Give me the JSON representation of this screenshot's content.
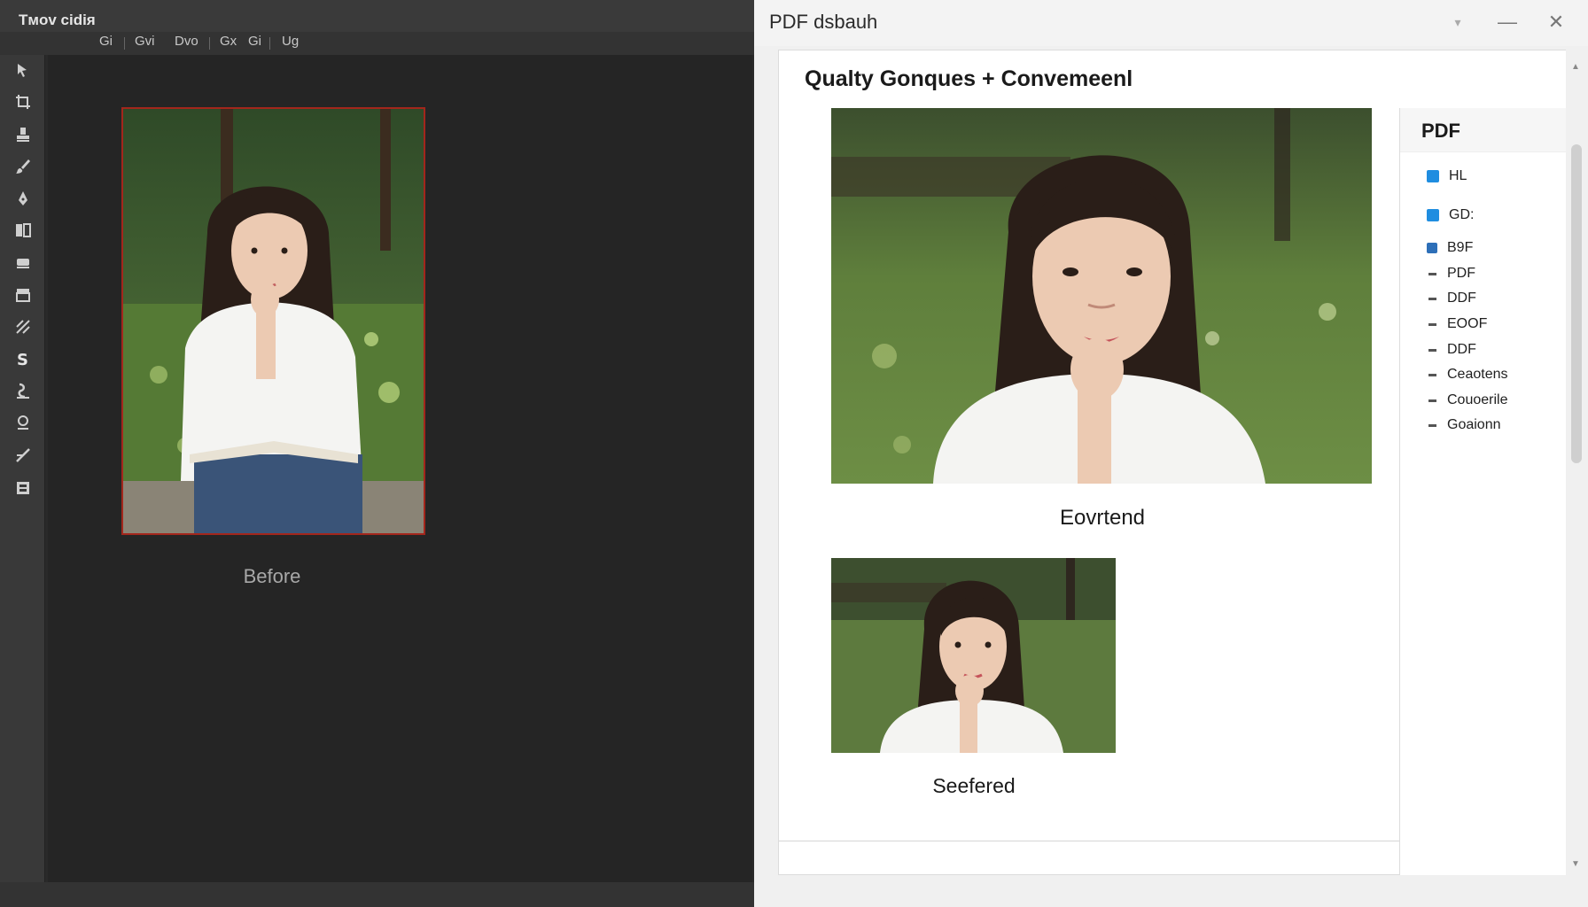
{
  "editor": {
    "title": "Tмov cidiя",
    "menu": [
      "Gi",
      "Gvi",
      "Dvo",
      "Gx",
      "Gi",
      "Ug"
    ],
    "tools": [
      "move-tool",
      "crop-tool",
      "stamp-tool",
      "brush-tool",
      "pen-tool",
      "clone-tool",
      "eraser-tool",
      "fill-tool",
      "gradient-tool",
      "type-tool",
      "smudge-tool",
      "dodge-tool",
      "line-tool",
      "layer-tool"
    ],
    "image_label": "Before"
  },
  "pdf_window": {
    "title": "PDF dsbauh",
    "controls": {
      "restore": "▾",
      "minimize": "—",
      "close": "✕"
    },
    "doc_heading": "Qualty Gonques + Convemeenl",
    "big_caption": "Eovrtend",
    "small_caption": "Seefered",
    "side_panel": {
      "heading": "PDF",
      "items": [
        {
          "label": "HL",
          "marker": "square"
        },
        {
          "label": "GD:",
          "marker": "square"
        },
        {
          "label": "B9F",
          "marker": "small-square"
        },
        {
          "label": "PDF",
          "marker": "dash"
        },
        {
          "label": "DDF",
          "marker": "dash"
        },
        {
          "label": "EOOF",
          "marker": "dash"
        },
        {
          "label": "DDF",
          "marker": "dash"
        },
        {
          "label": "Ceaotens",
          "marker": "dash"
        },
        {
          "label": "Couoerile",
          "marker": "dash"
        },
        {
          "label": "Goaionn",
          "marker": "dash"
        }
      ]
    }
  },
  "colors": {
    "accent": "#1f8de0",
    "selection_frame": "#a3261c"
  }
}
